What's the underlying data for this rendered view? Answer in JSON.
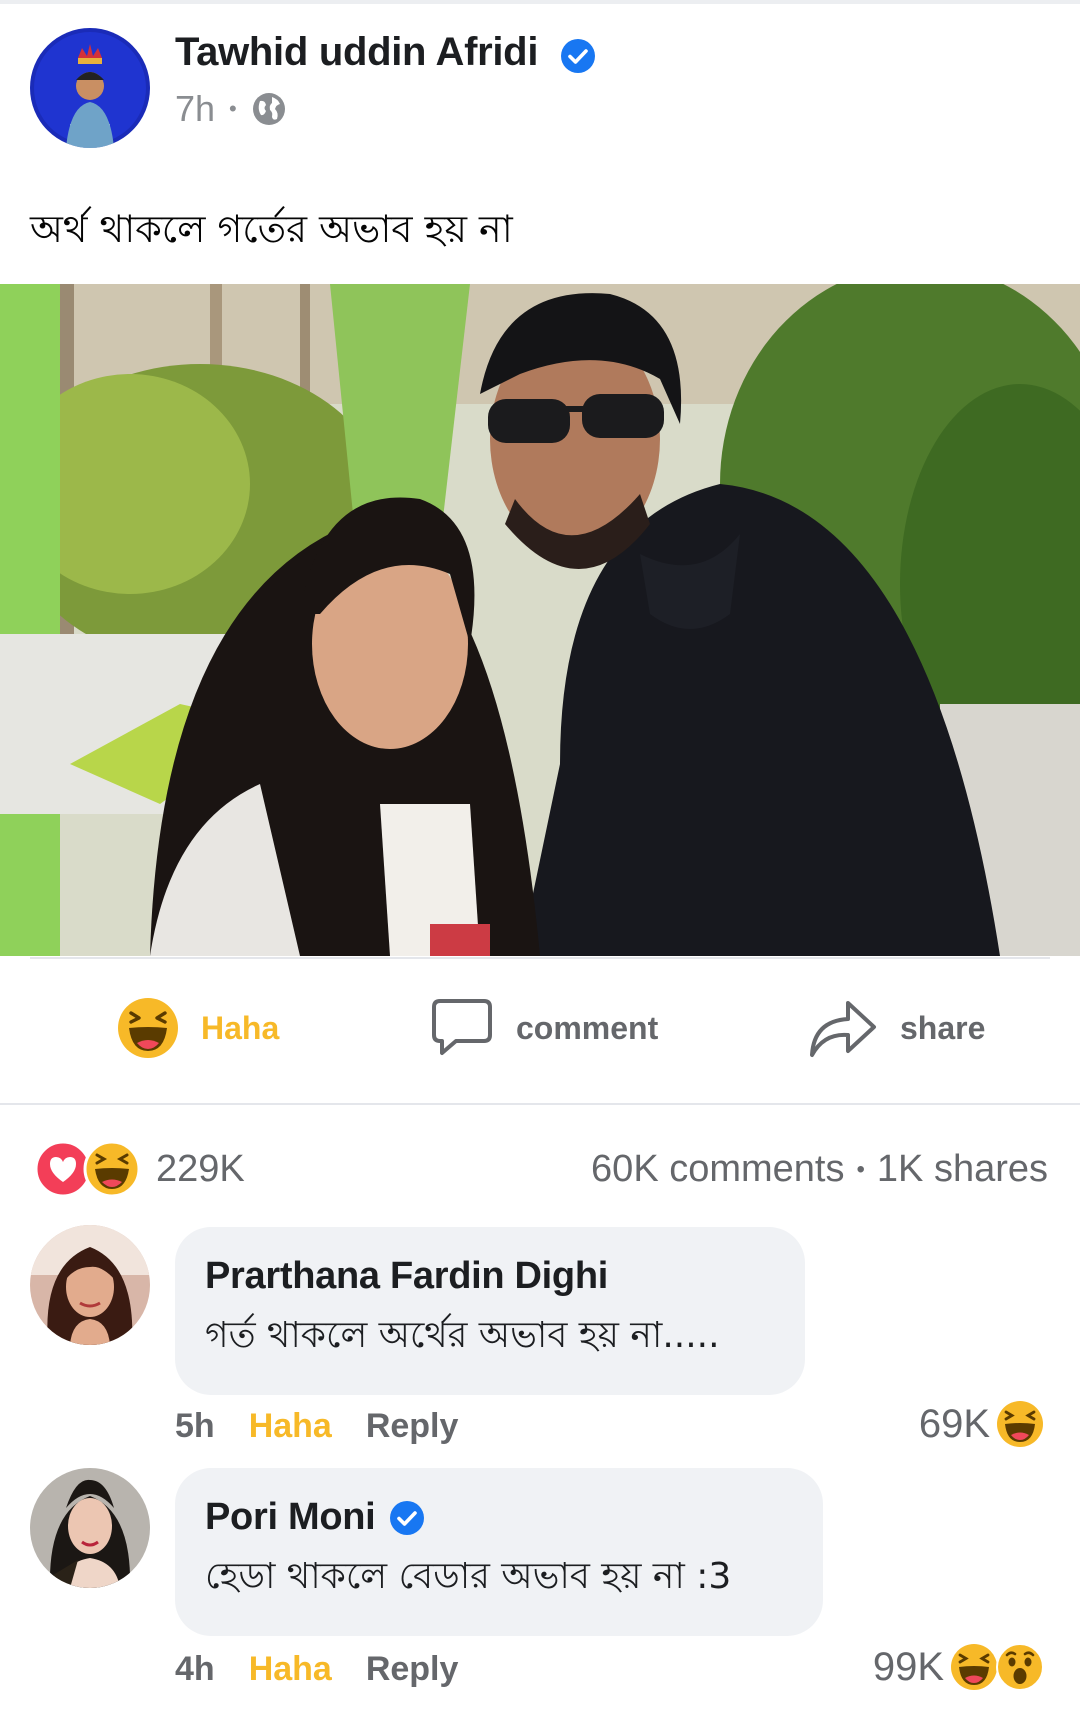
{
  "post": {
    "author": "Tawhid uddin Afridi",
    "verified": true,
    "time": "7h",
    "separator": "•",
    "audience_icon": "globe-icon",
    "text": "অর্থ থাকলে গর্তের অভাব হয় না"
  },
  "actions": {
    "haha_label": "Haha",
    "comment_label": "comment",
    "share_label": "share"
  },
  "summary": {
    "reaction_icons": [
      "love-icon",
      "haha-icon"
    ],
    "reaction_count": "229K",
    "comments": "60K comments",
    "separator": "•",
    "shares": "1K shares"
  },
  "comments": [
    {
      "name": "Prarthana Fardin Dighi",
      "verified": false,
      "text": "গর্ত থাকলে অর্থের অভাব হয় না.....",
      "time": "5h",
      "haha_label": "Haha",
      "reply_label": "Reply",
      "reaction_count": "69K",
      "reaction_icons": [
        "haha-icon"
      ]
    },
    {
      "name": "Pori Moni",
      "verified": true,
      "text": "হেডা থাকলে বেডার অভাব হয় না :3",
      "time": "4h",
      "haha_label": "Haha",
      "reply_label": "Reply",
      "reaction_count": "99K",
      "reaction_icons": [
        "haha-icon",
        "wow-icon"
      ]
    }
  ],
  "colors": {
    "verified_blue": "#1877f2",
    "haha_yellow": "#f7b928",
    "love_red": "#f33e58",
    "secondary_text": "#65676b",
    "bubble_bg": "#f0f2f5"
  }
}
